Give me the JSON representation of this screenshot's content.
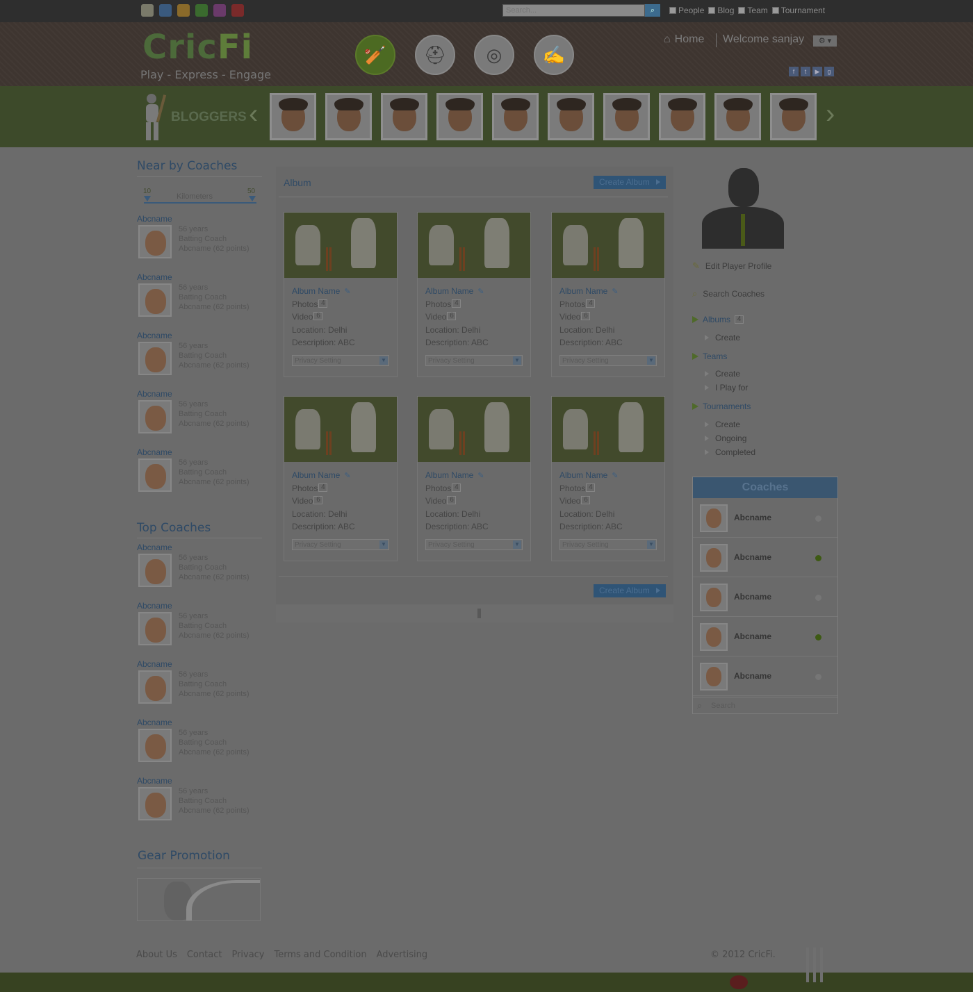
{
  "topbar": {
    "search_placeholder": "Search...",
    "filters": [
      "People",
      "Blog",
      "Team",
      "Tournament"
    ],
    "apps": [
      {
        "icon": "notepad-icon",
        "color": "#7a7a6a"
      },
      {
        "icon": "paint-icon",
        "color": "#3a5a7e"
      },
      {
        "icon": "pizza-icon",
        "color": "#8a6a2a"
      },
      {
        "icon": "tag-icon",
        "color": "#3a6a2e"
      },
      {
        "icon": "ribbon-icon",
        "color": "#6a3a6a"
      },
      {
        "icon": "checkmark-icon",
        "color": "#7a2a2a"
      }
    ]
  },
  "header": {
    "logo_main": "Cric",
    "logo_accent": "Fi",
    "tagline": "Play - Express - Engage",
    "home": "Home",
    "welcome": "Welcome sanjay",
    "gear_label": "⚙ ▾",
    "nav": [
      {
        "icon": "cricket-player-icon",
        "active": true
      },
      {
        "icon": "helmet-icon",
        "active": false
      },
      {
        "icon": "coach-whistle-icon",
        "active": false
      },
      {
        "icon": "pen-write-icon",
        "active": false
      }
    ],
    "socials": [
      {
        "icon": "facebook-icon",
        "glyph": "f"
      },
      {
        "icon": "twitter-icon",
        "glyph": "t"
      },
      {
        "icon": "youtube-icon",
        "glyph": "▶"
      },
      {
        "icon": "google-plus-icon",
        "glyph": "g"
      }
    ]
  },
  "bloggers": {
    "title": "BLOGGERS",
    "count": 10
  },
  "left": {
    "near_title": "Near by Coaches",
    "slider": {
      "min_label": "10",
      "max_label": "50",
      "unit": "Kilometers"
    },
    "near_coaches": [
      {
        "name": "Abcname",
        "age": "56 years",
        "role": "Batting Coach",
        "points": "Abcname (62 points)"
      },
      {
        "name": "Abcname",
        "age": "56 years",
        "role": "Batting Coach",
        "points": "Abcname (62 points)"
      },
      {
        "name": "Abcname",
        "age": "56 years",
        "role": "Batting Coach",
        "points": "Abcname (62 points)"
      },
      {
        "name": "Abcname",
        "age": "56 years",
        "role": "Batting Coach",
        "points": "Abcname (62 points)"
      },
      {
        "name": "Abcname",
        "age": "56 years",
        "role": "Batting Coach",
        "points": "Abcname (62 points)"
      }
    ],
    "top_title": "Top Coaches",
    "top_coaches": [
      {
        "name": "Abcname",
        "age": "56 years",
        "role": "Batting Coach",
        "points": "Abcname (62 points)"
      },
      {
        "name": "Abcname",
        "age": "56 years",
        "role": "Batting Coach",
        "points": "Abcname (62 points)"
      },
      {
        "name": "Abcname",
        "age": "56 years",
        "role": "Batting Coach",
        "points": "Abcname (62 points)"
      },
      {
        "name": "Abcname",
        "age": "56 years",
        "role": "Batting Coach",
        "points": "Abcname (62 points)"
      },
      {
        "name": "Abcname",
        "age": "56 years",
        "role": "Batting Coach",
        "points": "Abcname (62 points)"
      }
    ],
    "gear_title": "Gear Promotion"
  },
  "album": {
    "title": "Album",
    "create_label": "Create Album",
    "cards": [
      {
        "name": "Album Name",
        "photos_label": "Photos",
        "photos": "4",
        "video_label": "Video",
        "videos": "6",
        "location": "Location: Delhi",
        "description": "Description: ABC",
        "privacy": "Privacy Setting"
      },
      {
        "name": "Album Name",
        "photos_label": "Photos",
        "photos": "4",
        "video_label": "Video",
        "videos": "6",
        "location": "Location: Delhi",
        "description": "Description: ABC",
        "privacy": "Privacy Setting"
      },
      {
        "name": "Album Name",
        "photos_label": "Photos",
        "photos": "4",
        "video_label": "Video",
        "videos": "6",
        "location": "Location: Delhi",
        "description": "Description: ABC",
        "privacy": "Privacy Setting"
      },
      {
        "name": "Album Name",
        "photos_label": "Photos",
        "photos": "4",
        "video_label": "Video",
        "videos": "6",
        "location": "Location: Delhi",
        "description": "Description: ABC",
        "privacy": "Privacy Setting"
      },
      {
        "name": "Album Name",
        "photos_label": "Photos",
        "photos": "4",
        "video_label": "Video",
        "videos": "6",
        "location": "Location: Delhi",
        "description": "Description: ABC",
        "privacy": "Privacy Setting"
      },
      {
        "name": "Album Name",
        "photos_label": "Photos",
        "photos": "4",
        "video_label": "Video",
        "videos": "6",
        "location": "Location: Delhi",
        "description": "Description: ABC",
        "privacy": "Privacy Setting"
      }
    ]
  },
  "right": {
    "edit_profile": "Edit Player Profile",
    "search_coaches": "Search Coaches",
    "albums": {
      "label": "Albums",
      "count": "4",
      "children": [
        "Create"
      ]
    },
    "teams": {
      "label": "Teams",
      "children": [
        "Create",
        "I Play for"
      ]
    },
    "tournaments": {
      "label": "Tournaments",
      "children": [
        "Create",
        "Ongoing",
        "Completed"
      ]
    },
    "coaches_box": {
      "title": "Coaches",
      "items": [
        {
          "name": "Abcname",
          "online": false
        },
        {
          "name": "Abcname",
          "online": true
        },
        {
          "name": "Abcname",
          "online": false
        },
        {
          "name": "Abcname",
          "online": true
        },
        {
          "name": "Abcname",
          "online": false
        }
      ],
      "search_placeholder": "Search"
    }
  },
  "footer": {
    "links": [
      "About Us",
      "Contact",
      "Privacy",
      "Terms and Condition",
      "Advertising"
    ],
    "copyright": "© 2012 CricFi."
  }
}
